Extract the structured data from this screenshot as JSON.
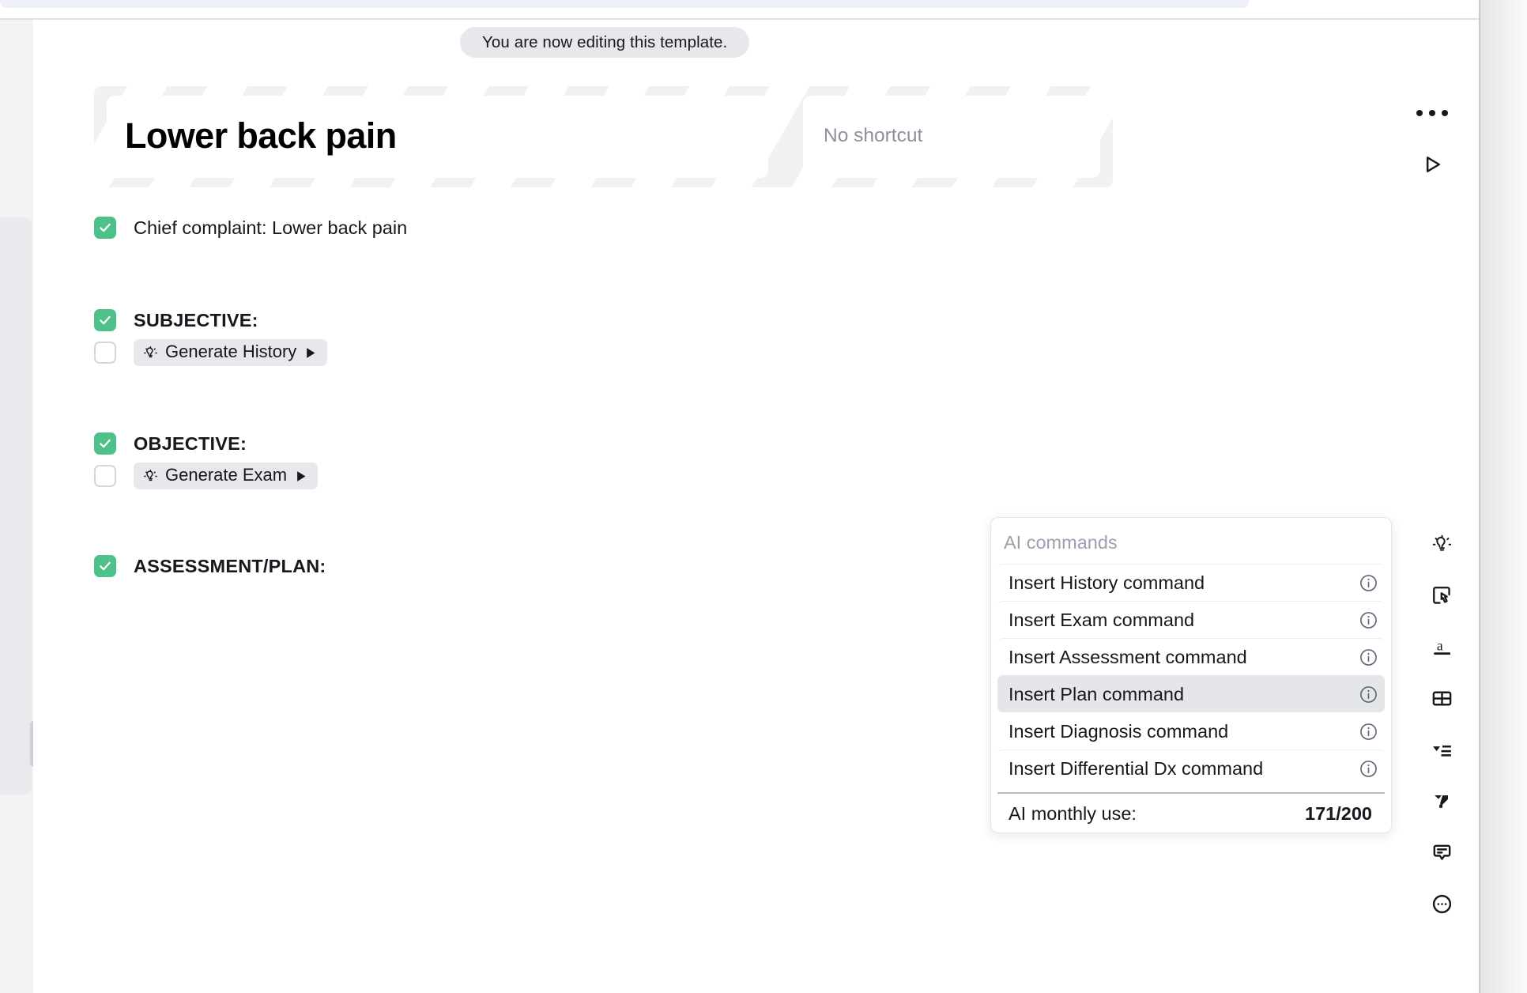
{
  "toast": {
    "message": "You are now editing this template."
  },
  "template": {
    "title": "Lower back pain",
    "shortcut_placeholder": "No shortcut"
  },
  "top_actions": [
    {
      "name": "more-options",
      "icon": "ellipsis-horizontal-icon"
    },
    {
      "name": "run-template",
      "icon": "play-outline-icon"
    }
  ],
  "outline": [
    {
      "id": "chief-complaint",
      "label": "Chief complaint: Lower back pain",
      "checked": true,
      "bold": false
    },
    {
      "id": "subjective",
      "label": "SUBJECTIVE:",
      "checked": true,
      "bold": true
    },
    {
      "id": "generate-history",
      "chip_label": "Generate History",
      "checked": false,
      "is_chip": true,
      "chip_icon": "lightbulb-icon",
      "chip_action_icon": "play-filled-icon"
    },
    {
      "id": "objective",
      "label": "OBJECTIVE:",
      "checked": true,
      "bold": true
    },
    {
      "id": "generate-exam",
      "chip_label": "Generate Exam",
      "checked": false,
      "is_chip": true,
      "chip_icon": "lightbulb-icon",
      "chip_action_icon": "play-filled-icon"
    },
    {
      "id": "assessment-plan",
      "label": "ASSESSMENT/PLAN:",
      "checked": true,
      "bold": true
    }
  ],
  "ai_panel": {
    "header": "AI commands",
    "items": [
      {
        "label": "Insert History command",
        "info_icon": "info-circle-icon",
        "selected": false
      },
      {
        "label": "Insert Exam command",
        "info_icon": "info-circle-icon",
        "selected": false
      },
      {
        "label": "Insert Assessment command",
        "info_icon": "info-circle-icon",
        "selected": false
      },
      {
        "label": "Insert Plan command",
        "info_icon": "info-circle-icon",
        "selected": true
      },
      {
        "label": "Insert Diagnosis command",
        "info_icon": "info-circle-icon",
        "selected": false
      },
      {
        "label": "Insert Differential Dx command",
        "info_icon": "info-circle-icon",
        "selected": false
      }
    ],
    "footer": {
      "label": "AI monthly use:",
      "value": "171/200"
    }
  },
  "right_rail": [
    {
      "name": "ai-suggestions",
      "icon": "lightbulb-icon"
    },
    {
      "name": "interactive-element",
      "icon": "tap-box-icon"
    },
    {
      "name": "text-format",
      "icon": "letter-a-underline-icon"
    },
    {
      "name": "insert-table",
      "icon": "table-icon"
    },
    {
      "name": "dropdown-list",
      "icon": "dropdown-list-icon"
    },
    {
      "name": "shortcut-snippet",
      "icon": "lightning-icon"
    },
    {
      "name": "comment",
      "icon": "comment-bubble-icon"
    },
    {
      "name": "more",
      "icon": "ellipsis-circle-icon"
    }
  ],
  "colors": {
    "checkbox_checked": "#4ec08a",
    "chip_background": "#e6e8ec",
    "toast_background": "#e6e8ec",
    "selected_row": "#e4e6ea",
    "muted_text": "#8c909c"
  }
}
